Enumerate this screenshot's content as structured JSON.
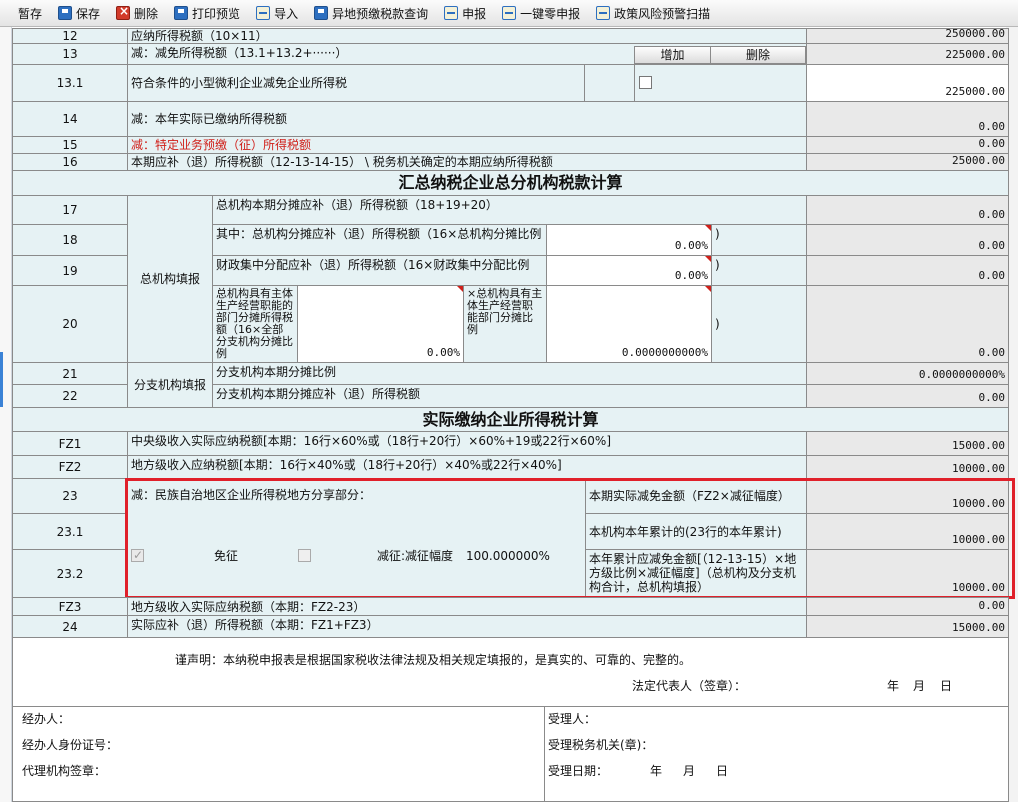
{
  "toolbar": {
    "items": [
      {
        "label": "暂存",
        "icon": "none"
      },
      {
        "label": "保存",
        "icon": "save-icon"
      },
      {
        "label": "删除",
        "icon": "delete-icon"
      },
      {
        "label": "打印预览",
        "icon": "print-preview-icon"
      },
      {
        "label": "导入",
        "icon": "import-icon"
      },
      {
        "label": "异地预缴税款查询",
        "icon": "query-icon"
      },
      {
        "label": "申报",
        "icon": "declare-icon"
      },
      {
        "label": "一键零申报",
        "icon": "zero-declare-icon"
      },
      {
        "label": "政策风险预警扫描",
        "icon": "risk-scan-icon"
      }
    ]
  },
  "rows": {
    "r12": {
      "no": "12",
      "label": "应纳所得税额（10×11）",
      "value": "250000.00"
    },
    "r13": {
      "no": "13",
      "label": "减：减免所得税额（13.1+13.2+······）",
      "value": "225000.00",
      "add": "增加",
      "del": "删除"
    },
    "r13_1": {
      "no": "13.1",
      "label": "符合条件的小型微利企业减免企业所得税",
      "value": "225000.00"
    },
    "r14": {
      "no": "14",
      "label": "减：本年实际已缴纳所得税额",
      "value": "0.00"
    },
    "r15": {
      "no": "15",
      "label": "减：特定业务预缴（征）所得税额",
      "value": "0.00"
    },
    "r16": {
      "no": "16",
      "label": "本期应补（退）所得税额（12-13-14-15） \\ 税务机关确定的本期应纳所得税额",
      "value": "25000.00"
    },
    "sec1": "汇总纳税企业总分机构税款计算",
    "r17": {
      "no": "17",
      "label": "总机构本期分摊应补（退）所得税额（18+19+20）",
      "value": "0.00"
    },
    "r18": {
      "no": "18",
      "label": "其中：总机构分摊应补（退）所得税额（16×总机构分摊比例",
      "ratio": "0.00%",
      "close": ")",
      "value": "0.00"
    },
    "r19": {
      "no": "19",
      "label": "财政集中分配应补（退）所得税额（16×财政集中分配比例",
      "ratio": "0.00%",
      "close": ")",
      "value": "0.00"
    },
    "r20": {
      "no": "20",
      "label_a": "总机构具有主体生产经营职能的部门分摊所得税额（16×全部分支机构分摊比例",
      "ratio_a": "0.00%",
      "label_b": "×总机构具有主体生产经营职能部门分摊比例",
      "ratio_b": "0.0000000000%",
      "close": ")",
      "value": "0.00"
    },
    "group_hq": "总机构填报",
    "r21": {
      "no": "21",
      "label": "分支机构本期分摊比例",
      "value": "0.0000000000%"
    },
    "r22": {
      "no": "22",
      "label": "分支机构本期分摊应补（退）所得税额",
      "value": "0.00"
    },
    "group_branch": "分支机构填报",
    "sec2": "实际缴纳企业所得税计算",
    "fz1": {
      "no": "FZ1",
      "label": "中央级收入实际应纳税额[本期：16行×60%或（18行+20行）×60%+19或22行×60%]",
      "value": "15000.00"
    },
    "fz2": {
      "no": "FZ2",
      "label": "地方级收入应纳税额[本期：16行×40%或（18行+20行）×40%或22行×40%]",
      "value": "10000.00"
    },
    "r23": {
      "no": "23",
      "label": "本期实际减免金额（FZ2×减征幅度）",
      "value": "10000.00"
    },
    "r23_1": {
      "no": "23.1",
      "label": "本机构本年累计的(23行的本年累计)",
      "value": "10000.00"
    },
    "r23_2": {
      "no": "23.2",
      "label": "本年累计应减免金额[（12-13-15）×地方级比例×减征幅度]（总机构及分支机构合计，总机构填报）",
      "value": "10000.00"
    },
    "minzu": {
      "title": "减：民族自治地区企业所得税地方分享部分：",
      "exempt": "免征",
      "reduce": "减征:减征幅度",
      "rate": "100.000000%"
    },
    "fz3": {
      "no": "FZ3",
      "label": "地方级收入实际应纳税额（本期：FZ2-23）",
      "value": "0.00"
    },
    "r24": {
      "no": "24",
      "label": "实际应补（退）所得税额（本期：FZ1+FZ3）",
      "value": "15000.00"
    }
  },
  "declaration": {
    "statement": "谨声明：本纳税申报表是根据国家税收法律法规及相关规定填报的，是真实的、可靠的、完整的。",
    "legal_rep": "法定代表人（签章）：",
    "year": "年",
    "month": "月",
    "day": "日"
  },
  "signature": {
    "handler": "经办人：",
    "handler_id": "经办人身份证号：",
    "agent_seal": "代理机构签章：",
    "receiver": "受理人：",
    "tax_office": "受理税务机关(章)：",
    "receive_date": "受理日期：",
    "year": "年",
    "month": "月",
    "day": "日"
  }
}
